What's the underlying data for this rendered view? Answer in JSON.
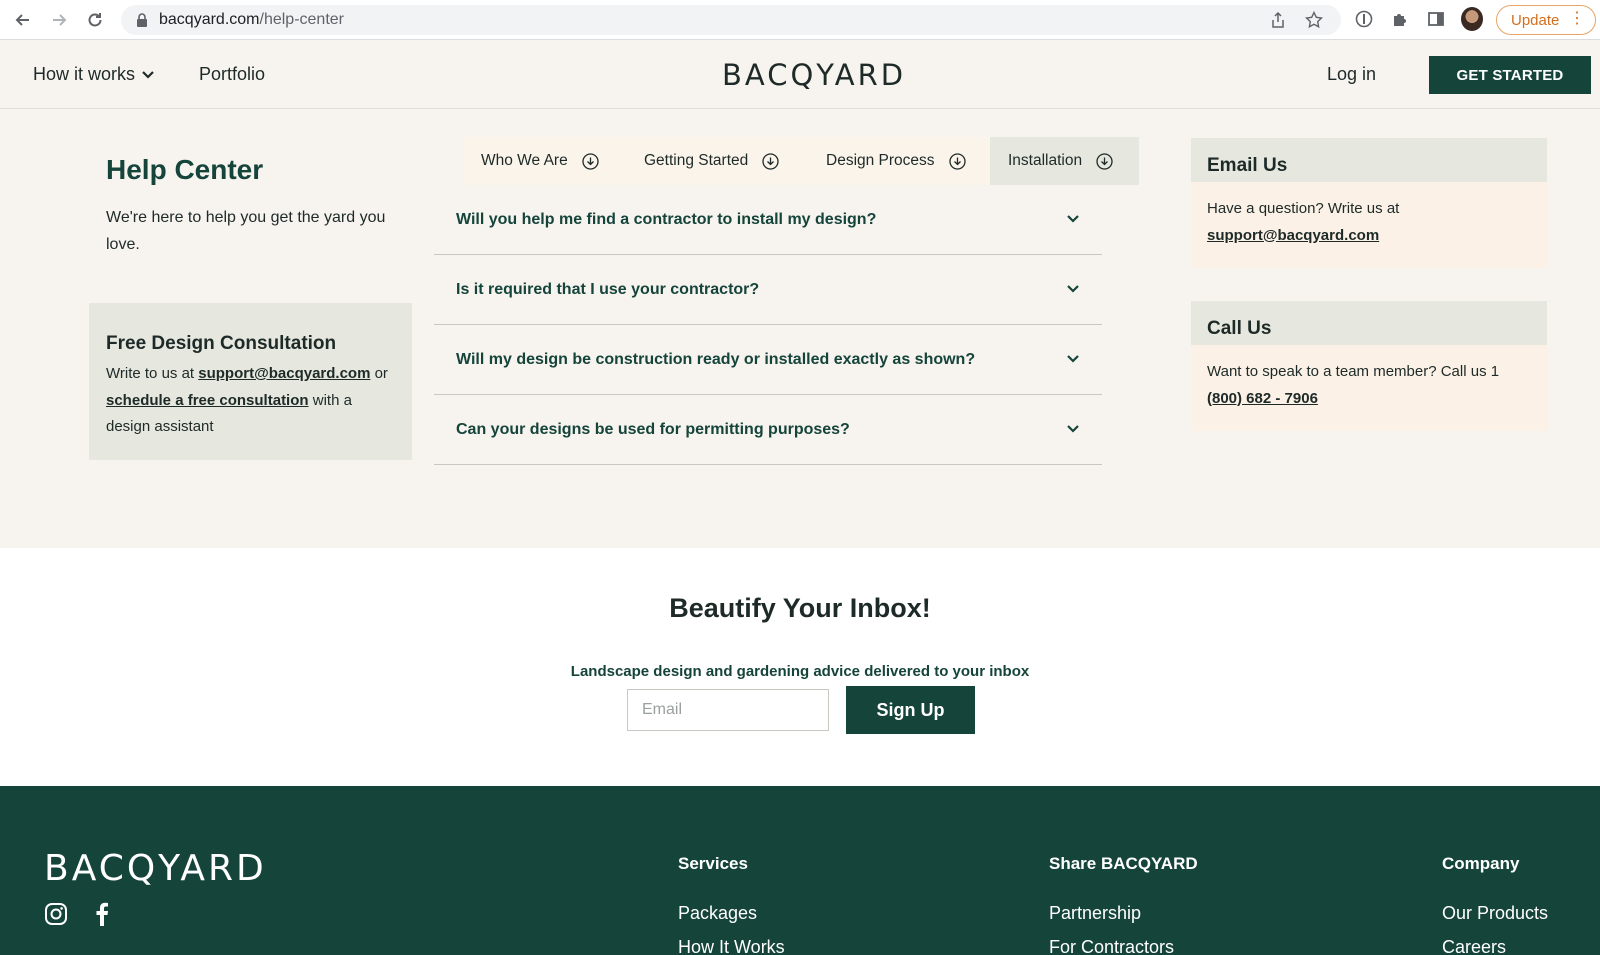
{
  "browser": {
    "url_host": "bacqyard.com",
    "url_path": "/help-center",
    "update_label": "Update"
  },
  "header": {
    "nav_how": "How it works",
    "nav_portfolio": "Portfolio",
    "logo": "BACQYARD",
    "login": "Log in",
    "cta": "GET STARTED"
  },
  "help": {
    "title": "Help Center",
    "subtitle": "We're here to help you get the yard you love."
  },
  "consult": {
    "title": "Free Design Consultation",
    "text_prefix": "Write to us at ",
    "email": "support@bacqyard.com",
    "text_mid": " or ",
    "link": "schedule a free consultation",
    "text_suffix": " with a design assistant"
  },
  "tabs": [
    {
      "label": "Who We Are"
    },
    {
      "label": "Getting Started"
    },
    {
      "label": "Design Process"
    },
    {
      "label": "Installation"
    }
  ],
  "faqs": [
    {
      "q": "Will you help me find a contractor to install my design?"
    },
    {
      "q": "Is it required that I use your contractor?"
    },
    {
      "q": "Will my design be construction ready or installed exactly as shown?"
    },
    {
      "q": "Can your designs be used for permitting purposes?"
    }
  ],
  "email_card": {
    "title": "Email Us",
    "text": "Have a question? Write us at",
    "email": "support@bacqyard.com"
  },
  "call_card": {
    "title": "Call Us",
    "text": "Want to speak to a team member? Call us 1",
    "phone": "(800) 682 - 7906"
  },
  "newsletter": {
    "title": "Beautify Your Inbox!",
    "subtitle": "Landscape design and gardening advice delivered to your inbox",
    "placeholder": "Email",
    "button": "Sign Up"
  },
  "footer": {
    "logo": "BACQYARD",
    "services": {
      "heading": "Services",
      "items": [
        "Packages",
        "How It Works"
      ]
    },
    "share": {
      "heading": "Share BACQYARD",
      "items": [
        "Partnership",
        "For Contractors"
      ]
    },
    "company": {
      "heading": "Company",
      "items": [
        "Our Products",
        "Careers"
      ]
    }
  },
  "colors": {
    "brand_green": "#15443a",
    "page_bg": "#f7f3ef",
    "card_head": "#e6e8df",
    "card_body": "#fbf1e6"
  }
}
